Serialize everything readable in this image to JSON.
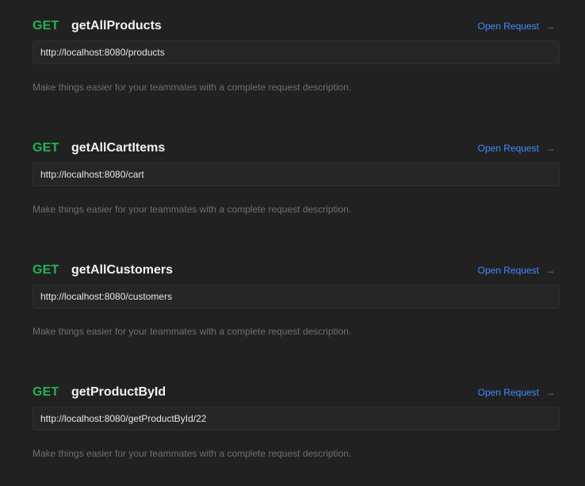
{
  "requests": [
    {
      "method": "GET",
      "name": "getAllProducts",
      "open_label": "Open Request",
      "url": "http://localhost:8080/products",
      "description": "Make things easier for your teammates with a complete request description."
    },
    {
      "method": "GET",
      "name": "getAllCartItems",
      "open_label": "Open Request",
      "url": "http://localhost:8080/cart",
      "description": "Make things easier for your teammates with a complete request description."
    },
    {
      "method": "GET",
      "name": "getAllCustomers",
      "open_label": "Open Request",
      "url": "http://localhost:8080/customers",
      "description": "Make things easier for your teammates with a complete request description."
    },
    {
      "method": "GET",
      "name": "getProductById",
      "open_label": "Open Request",
      "url": "http://localhost:8080/getProductById/22",
      "description": "Make things easier for your teammates with a complete request description."
    }
  ],
  "icons": {
    "open_request": "arrow-right-icon"
  },
  "colors": {
    "background": "#212121",
    "method_get": "#22b455",
    "link": "#3f8cff",
    "description": "#6f6f6f"
  }
}
